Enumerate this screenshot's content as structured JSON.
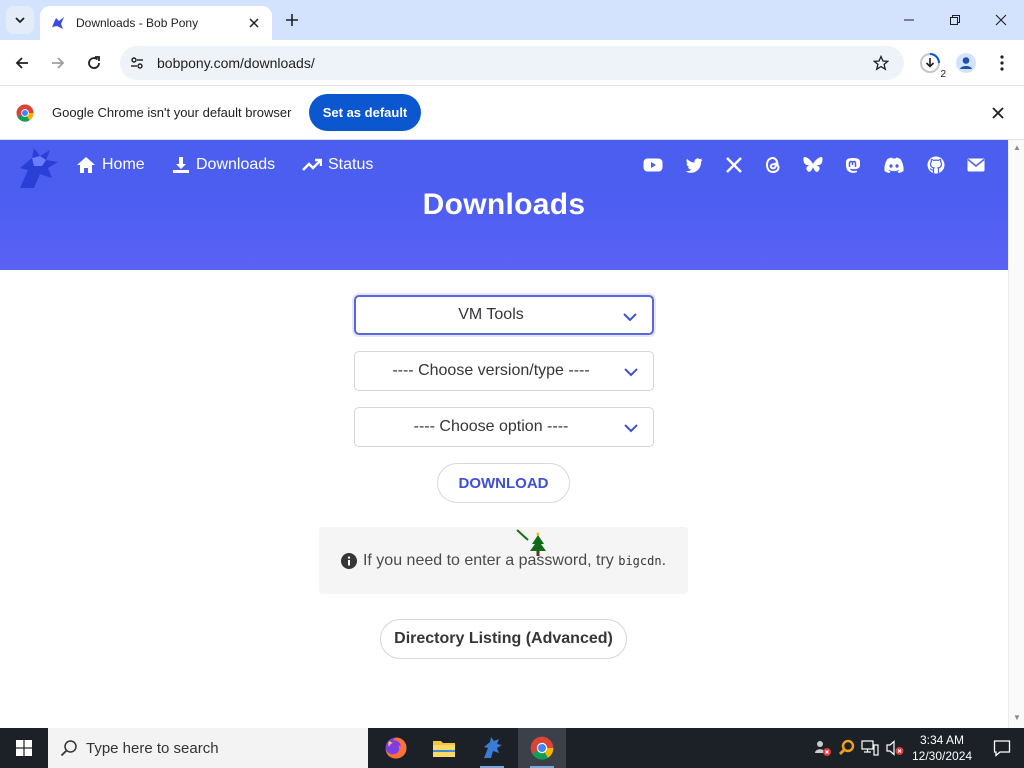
{
  "browser": {
    "tab_title": "Downloads - Bob Pony",
    "url": "bobpony.com/downloads/",
    "downloads_badge": "2"
  },
  "infobar": {
    "message": "Google Chrome isn't your default browser",
    "button": "Set as default"
  },
  "site": {
    "nav": [
      {
        "label": "Home",
        "icon": "home-icon"
      },
      {
        "label": "Downloads",
        "icon": "download-icon"
      },
      {
        "label": "Status",
        "icon": "trend-icon"
      }
    ],
    "social_icons": [
      "youtube-icon",
      "twitter-icon",
      "x-icon",
      "threads-icon",
      "bluesky-icon",
      "mastodon-icon",
      "discord-icon",
      "github-icon",
      "mail-icon"
    ],
    "hero_title": "Downloads",
    "accent": "#4b5ef0"
  },
  "form": {
    "category_value": "VM Tools",
    "version_value": "---- Choose version/type ----",
    "option_value": "---- Choose option ----",
    "download_label": "DOWNLOAD"
  },
  "notice": {
    "text_before": "If you need to enter a password, try ",
    "code": "bigcdn",
    "text_after": "."
  },
  "directory_button": "Directory Listing (Advanced)",
  "taskbar": {
    "search_placeholder": "Type here to search",
    "time": "3:34 AM",
    "date": "12/30/2024"
  }
}
